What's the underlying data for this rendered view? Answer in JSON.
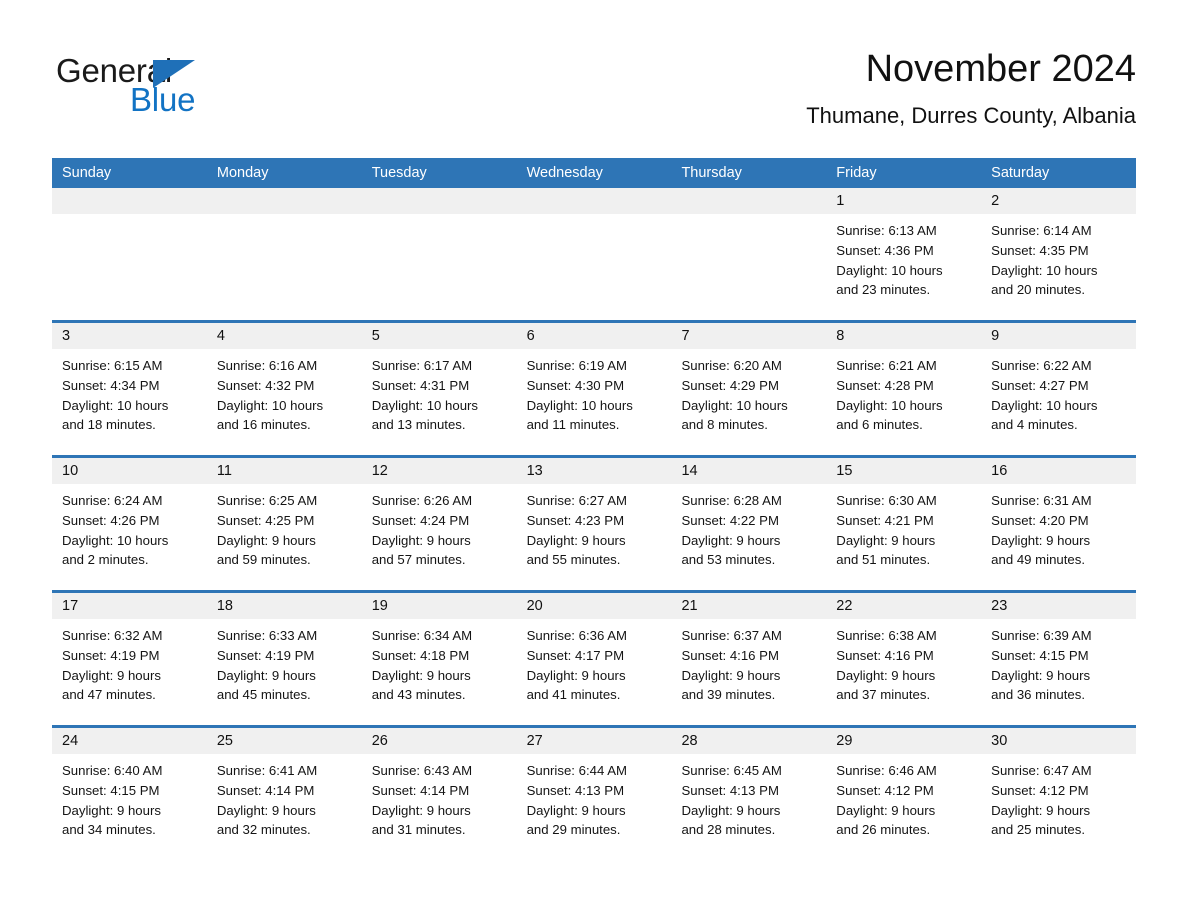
{
  "brand": {
    "name_part1": "General",
    "name_part2": "Blue",
    "triangle_color": "#1f70b8",
    "blue_color": "#1273c4"
  },
  "header": {
    "month_title": "November 2024",
    "location": "Thumane, Durres County, Albania"
  },
  "theme": {
    "header_blue": "#2e75b6",
    "daynum_strip": "#f0f0f0",
    "cell_background": "#ffffff",
    "text": "#111111"
  },
  "weekdays": [
    "Sunday",
    "Monday",
    "Tuesday",
    "Wednesday",
    "Thursday",
    "Friday",
    "Saturday"
  ],
  "weeks": [
    [
      {
        "day": "",
        "sunrise": "",
        "sunset": "",
        "daylight_line1": "",
        "daylight_line2": ""
      },
      {
        "day": "",
        "sunrise": "",
        "sunset": "",
        "daylight_line1": "",
        "daylight_line2": ""
      },
      {
        "day": "",
        "sunrise": "",
        "sunset": "",
        "daylight_line1": "",
        "daylight_line2": ""
      },
      {
        "day": "",
        "sunrise": "",
        "sunset": "",
        "daylight_line1": "",
        "daylight_line2": ""
      },
      {
        "day": "",
        "sunrise": "",
        "sunset": "",
        "daylight_line1": "",
        "daylight_line2": ""
      },
      {
        "day": "1",
        "sunrise": "Sunrise: 6:13 AM",
        "sunset": "Sunset: 4:36 PM",
        "daylight_line1": "Daylight: 10 hours",
        "daylight_line2": "and 23 minutes."
      },
      {
        "day": "2",
        "sunrise": "Sunrise: 6:14 AM",
        "sunset": "Sunset: 4:35 PM",
        "daylight_line1": "Daylight: 10 hours",
        "daylight_line2": "and 20 minutes."
      }
    ],
    [
      {
        "day": "3",
        "sunrise": "Sunrise: 6:15 AM",
        "sunset": "Sunset: 4:34 PM",
        "daylight_line1": "Daylight: 10 hours",
        "daylight_line2": "and 18 minutes."
      },
      {
        "day": "4",
        "sunrise": "Sunrise: 6:16 AM",
        "sunset": "Sunset: 4:32 PM",
        "daylight_line1": "Daylight: 10 hours",
        "daylight_line2": "and 16 minutes."
      },
      {
        "day": "5",
        "sunrise": "Sunrise: 6:17 AM",
        "sunset": "Sunset: 4:31 PM",
        "daylight_line1": "Daylight: 10 hours",
        "daylight_line2": "and 13 minutes."
      },
      {
        "day": "6",
        "sunrise": "Sunrise: 6:19 AM",
        "sunset": "Sunset: 4:30 PM",
        "daylight_line1": "Daylight: 10 hours",
        "daylight_line2": "and 11 minutes."
      },
      {
        "day": "7",
        "sunrise": "Sunrise: 6:20 AM",
        "sunset": "Sunset: 4:29 PM",
        "daylight_line1": "Daylight: 10 hours",
        "daylight_line2": "and 8 minutes."
      },
      {
        "day": "8",
        "sunrise": "Sunrise: 6:21 AM",
        "sunset": "Sunset: 4:28 PM",
        "daylight_line1": "Daylight: 10 hours",
        "daylight_line2": "and 6 minutes."
      },
      {
        "day": "9",
        "sunrise": "Sunrise: 6:22 AM",
        "sunset": "Sunset: 4:27 PM",
        "daylight_line1": "Daylight: 10 hours",
        "daylight_line2": "and 4 minutes."
      }
    ],
    [
      {
        "day": "10",
        "sunrise": "Sunrise: 6:24 AM",
        "sunset": "Sunset: 4:26 PM",
        "daylight_line1": "Daylight: 10 hours",
        "daylight_line2": "and 2 minutes."
      },
      {
        "day": "11",
        "sunrise": "Sunrise: 6:25 AM",
        "sunset": "Sunset: 4:25 PM",
        "daylight_line1": "Daylight: 9 hours",
        "daylight_line2": "and 59 minutes."
      },
      {
        "day": "12",
        "sunrise": "Sunrise: 6:26 AM",
        "sunset": "Sunset: 4:24 PM",
        "daylight_line1": "Daylight: 9 hours",
        "daylight_line2": "and 57 minutes."
      },
      {
        "day": "13",
        "sunrise": "Sunrise: 6:27 AM",
        "sunset": "Sunset: 4:23 PM",
        "daylight_line1": "Daylight: 9 hours",
        "daylight_line2": "and 55 minutes."
      },
      {
        "day": "14",
        "sunrise": "Sunrise: 6:28 AM",
        "sunset": "Sunset: 4:22 PM",
        "daylight_line1": "Daylight: 9 hours",
        "daylight_line2": "and 53 minutes."
      },
      {
        "day": "15",
        "sunrise": "Sunrise: 6:30 AM",
        "sunset": "Sunset: 4:21 PM",
        "daylight_line1": "Daylight: 9 hours",
        "daylight_line2": "and 51 minutes."
      },
      {
        "day": "16",
        "sunrise": "Sunrise: 6:31 AM",
        "sunset": "Sunset: 4:20 PM",
        "daylight_line1": "Daylight: 9 hours",
        "daylight_line2": "and 49 minutes."
      }
    ],
    [
      {
        "day": "17",
        "sunrise": "Sunrise: 6:32 AM",
        "sunset": "Sunset: 4:19 PM",
        "daylight_line1": "Daylight: 9 hours",
        "daylight_line2": "and 47 minutes."
      },
      {
        "day": "18",
        "sunrise": "Sunrise: 6:33 AM",
        "sunset": "Sunset: 4:19 PM",
        "daylight_line1": "Daylight: 9 hours",
        "daylight_line2": "and 45 minutes."
      },
      {
        "day": "19",
        "sunrise": "Sunrise: 6:34 AM",
        "sunset": "Sunset: 4:18 PM",
        "daylight_line1": "Daylight: 9 hours",
        "daylight_line2": "and 43 minutes."
      },
      {
        "day": "20",
        "sunrise": "Sunrise: 6:36 AM",
        "sunset": "Sunset: 4:17 PM",
        "daylight_line1": "Daylight: 9 hours",
        "daylight_line2": "and 41 minutes."
      },
      {
        "day": "21",
        "sunrise": "Sunrise: 6:37 AM",
        "sunset": "Sunset: 4:16 PM",
        "daylight_line1": "Daylight: 9 hours",
        "daylight_line2": "and 39 minutes."
      },
      {
        "day": "22",
        "sunrise": "Sunrise: 6:38 AM",
        "sunset": "Sunset: 4:16 PM",
        "daylight_line1": "Daylight: 9 hours",
        "daylight_line2": "and 37 minutes."
      },
      {
        "day": "23",
        "sunrise": "Sunrise: 6:39 AM",
        "sunset": "Sunset: 4:15 PM",
        "daylight_line1": "Daylight: 9 hours",
        "daylight_line2": "and 36 minutes."
      }
    ],
    [
      {
        "day": "24",
        "sunrise": "Sunrise: 6:40 AM",
        "sunset": "Sunset: 4:15 PM",
        "daylight_line1": "Daylight: 9 hours",
        "daylight_line2": "and 34 minutes."
      },
      {
        "day": "25",
        "sunrise": "Sunrise: 6:41 AM",
        "sunset": "Sunset: 4:14 PM",
        "daylight_line1": "Daylight: 9 hours",
        "daylight_line2": "and 32 minutes."
      },
      {
        "day": "26",
        "sunrise": "Sunrise: 6:43 AM",
        "sunset": "Sunset: 4:14 PM",
        "daylight_line1": "Daylight: 9 hours",
        "daylight_line2": "and 31 minutes."
      },
      {
        "day": "27",
        "sunrise": "Sunrise: 6:44 AM",
        "sunset": "Sunset: 4:13 PM",
        "daylight_line1": "Daylight: 9 hours",
        "daylight_line2": "and 29 minutes."
      },
      {
        "day": "28",
        "sunrise": "Sunrise: 6:45 AM",
        "sunset": "Sunset: 4:13 PM",
        "daylight_line1": "Daylight: 9 hours",
        "daylight_line2": "and 28 minutes."
      },
      {
        "day": "29",
        "sunrise": "Sunrise: 6:46 AM",
        "sunset": "Sunset: 4:12 PM",
        "daylight_line1": "Daylight: 9 hours",
        "daylight_line2": "and 26 minutes."
      },
      {
        "day": "30",
        "sunrise": "Sunrise: 6:47 AM",
        "sunset": "Sunset: 4:12 PM",
        "daylight_line1": "Daylight: 9 hours",
        "daylight_line2": "and 25 minutes."
      }
    ]
  ]
}
